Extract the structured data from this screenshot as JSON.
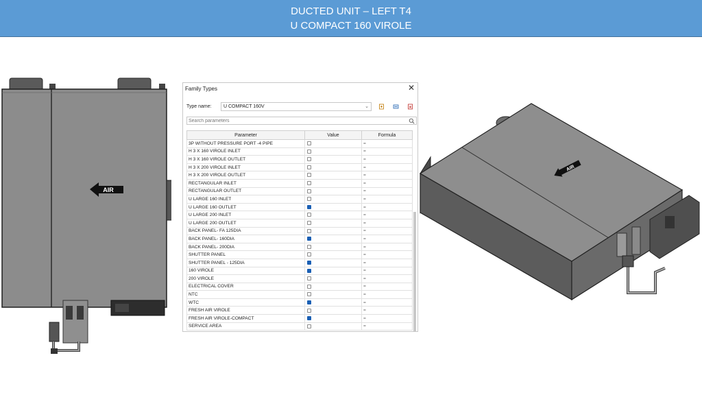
{
  "title": {
    "line1": "DUCTED UNIT – LEFT  T4",
    "line2": "U COMPACT  160 VIROLE"
  },
  "left_drawing": {
    "arrow_label": "AIR"
  },
  "right_drawing": {
    "arrow_label": "AIR"
  },
  "dialog": {
    "title": "Family Types",
    "close_glyph": "✕",
    "type_name_label": "Type name:",
    "type_name_value": "U COMPACT 160V",
    "dropdown_glyph": "⌄",
    "search_placeholder": "Search parameters",
    "columns": [
      "Parameter",
      "Value",
      "Formula"
    ],
    "rows": [
      {
        "parameter": "3P WITHOUT PRESSURE PORT -4  PIPE",
        "checked": false,
        "formula": "="
      },
      {
        "parameter": "H  3 X 160 VIROLE INLET",
        "checked": false,
        "formula": "="
      },
      {
        "parameter": "H  3 X 160 VIROLE OUTLET",
        "checked": false,
        "formula": "="
      },
      {
        "parameter": "H  3 X 200 VIROLE INLET",
        "checked": false,
        "formula": "="
      },
      {
        "parameter": "H  3 X 200 VIROLE OUTLET",
        "checked": false,
        "formula": "="
      },
      {
        "parameter": "RECTANGULAR INLET",
        "checked": false,
        "formula": "="
      },
      {
        "parameter": "RECTANGULAR OUTLET",
        "checked": false,
        "formula": "="
      },
      {
        "parameter": "U LARGE 160 INLET",
        "checked": false,
        "formula": "="
      },
      {
        "parameter": "U LARGE 160 OUTLET",
        "checked": true,
        "formula": "="
      },
      {
        "parameter": "U LARGE 200 INLET",
        "checked": false,
        "formula": "="
      },
      {
        "parameter": "U LARGE 200 OUTLET",
        "checked": false,
        "formula": "="
      },
      {
        "parameter": "BACK PANEL- FA 125DIA",
        "checked": false,
        "formula": "="
      },
      {
        "parameter": "BACK PANEL- 160DIA",
        "checked": true,
        "formula": "="
      },
      {
        "parameter": "BACK PANEL- 200DIA",
        "checked": false,
        "formula": "="
      },
      {
        "parameter": "SHUTTER PANEL",
        "checked": false,
        "formula": "="
      },
      {
        "parameter": "SHUTTER PANEL - 125DIA",
        "checked": true,
        "formula": "="
      },
      {
        "parameter": "160 VIROLE",
        "checked": true,
        "formula": "="
      },
      {
        "parameter": "200 VIROLE",
        "checked": false,
        "formula": "="
      },
      {
        "parameter": "ELECTRICAL COVER",
        "checked": false,
        "formula": "="
      },
      {
        "parameter": "NTC",
        "checked": false,
        "formula": "="
      },
      {
        "parameter": "WTC",
        "checked": true,
        "formula": "="
      },
      {
        "parameter": "FRESH AIR VIROLE",
        "checked": false,
        "formula": "="
      },
      {
        "parameter": "FRESH AIR VIROLE-COMPACT",
        "checked": true,
        "formula": "="
      },
      {
        "parameter": "SERVICE AREA",
        "checked": false,
        "formula": "="
      }
    ]
  },
  "colors": {
    "banner": "#5b9bd5",
    "checkbox_on": "#1a5fb4",
    "unit_body": "#8c8c8c"
  },
  "icons": [
    "close-icon",
    "chevron-down-icon",
    "new-type-icon",
    "rename-type-icon",
    "delete-type-icon",
    "search-icon"
  ]
}
